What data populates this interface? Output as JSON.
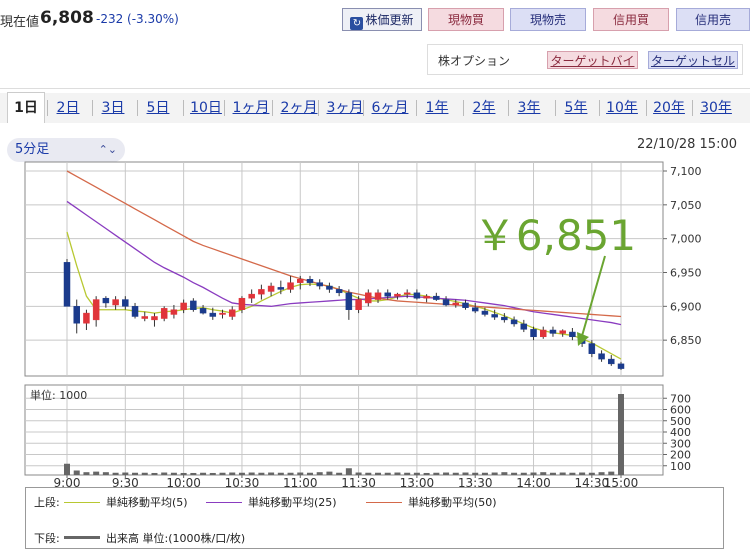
{
  "header": {
    "label": "現在値",
    "price": "6,808",
    "change": "-232 (-3.30%)",
    "update_button": "株価更新",
    "buttons": [
      "現物買",
      "現物売",
      "信用買",
      "信用売"
    ]
  },
  "options": {
    "label": "株オプション",
    "target_buy": "ターゲットバイ",
    "target_sell": "ターゲットセル"
  },
  "tabs": [
    "1日",
    "2日",
    "3日",
    "5日",
    "10日",
    "1ヶ月",
    "2ヶ月",
    "3ヶ月",
    "6ヶ月",
    "1年",
    "2年",
    "3年",
    "5年",
    "10年",
    "20年",
    "30年"
  ],
  "active_tab": "1日",
  "interval_select": "5分足",
  "datetime": "22/10/28 15:00",
  "annotation": {
    "text": "￥6,851",
    "color": "#6aa531"
  },
  "colors": {
    "up": "#e0343a",
    "down": "#1b3b8c",
    "ma5": "#b8c832",
    "ma25": "#8a3cc0",
    "ma50": "#d4694a",
    "volume": "#666666"
  },
  "chart_data": [
    {
      "type": "candlestick",
      "title": "",
      "x_ticks": [
        "9:00",
        "9:30",
        "10:00",
        "10:30",
        "11:00",
        "11:30",
        "13:00",
        "13:30",
        "14:00",
        "14:30",
        "15:00"
      ],
      "y_ticks": [
        "7,100",
        "7,050",
        "7,000",
        "6,950",
        "6,900",
        "6,850"
      ],
      "ylim": [
        6800,
        7100
      ],
      "grid": true,
      "candles": [
        {
          "o": 6965,
          "h": 6970,
          "l": 6900,
          "c": 6900
        },
        {
          "o": 6900,
          "h": 6910,
          "l": 6860,
          "c": 6875
        },
        {
          "o": 6875,
          "h": 6895,
          "l": 6865,
          "c": 6890
        },
        {
          "o": 6880,
          "h": 6915,
          "l": 6870,
          "c": 6910
        },
        {
          "o": 6912,
          "h": 6915,
          "l": 6898,
          "c": 6905
        },
        {
          "o": 6902,
          "h": 6915,
          "l": 6895,
          "c": 6910
        },
        {
          "o": 6910,
          "h": 6915,
          "l": 6895,
          "c": 6900
        },
        {
          "o": 6900,
          "h": 6905,
          "l": 6882,
          "c": 6885
        },
        {
          "o": 6882,
          "h": 6892,
          "l": 6878,
          "c": 6885
        },
        {
          "o": 6880,
          "h": 6890,
          "l": 6870,
          "c": 6885
        },
        {
          "o": 6882,
          "h": 6900,
          "l": 6878,
          "c": 6897
        },
        {
          "o": 6888,
          "h": 6902,
          "l": 6882,
          "c": 6895
        },
        {
          "o": 6895,
          "h": 6910,
          "l": 6890,
          "c": 6905
        },
        {
          "o": 6908,
          "h": 6912,
          "l": 6892,
          "c": 6895
        },
        {
          "o": 6897,
          "h": 6902,
          "l": 6888,
          "c": 6890
        },
        {
          "o": 6890,
          "h": 6898,
          "l": 6880,
          "c": 6885
        },
        {
          "o": 6888,
          "h": 6895,
          "l": 6882,
          "c": 6890
        },
        {
          "o": 6885,
          "h": 6900,
          "l": 6880,
          "c": 6895
        },
        {
          "o": 6895,
          "h": 6915,
          "l": 6890,
          "c": 6912
        },
        {
          "o": 6912,
          "h": 6925,
          "l": 6905,
          "c": 6918
        },
        {
          "o": 6918,
          "h": 6932,
          "l": 6910,
          "c": 6925
        },
        {
          "o": 6922,
          "h": 6935,
          "l": 6915,
          "c": 6930
        },
        {
          "o": 6928,
          "h": 6938,
          "l": 6918,
          "c": 6925
        },
        {
          "o": 6925,
          "h": 6945,
          "l": 6920,
          "c": 6935
        },
        {
          "o": 6935,
          "h": 6945,
          "l": 6925,
          "c": 6940
        },
        {
          "o": 6940,
          "h": 6945,
          "l": 6930,
          "c": 6935
        },
        {
          "o": 6935,
          "h": 6940,
          "l": 6925,
          "c": 6930
        },
        {
          "o": 6930,
          "h": 6935,
          "l": 6920,
          "c": 6925
        },
        {
          "o": 6925,
          "h": 6930,
          "l": 6915,
          "c": 6920
        },
        {
          "o": 6920,
          "h": 6925,
          "l": 6880,
          "c": 6895
        },
        {
          "o": 6895,
          "h": 6915,
          "l": 6890,
          "c": 6910
        },
        {
          "o": 6905,
          "h": 6925,
          "l": 6900,
          "c": 6920
        },
        {
          "o": 6910,
          "h": 6925,
          "l": 6905,
          "c": 6920
        },
        {
          "o": 6920,
          "h": 6925,
          "l": 6910,
          "c": 6915
        },
        {
          "o": 6915,
          "h": 6920,
          "l": 6910,
          "c": 6918
        },
        {
          "o": 6918,
          "h": 6925,
          "l": 6912,
          "c": 6920
        },
        {
          "o": 6920,
          "h": 6925,
          "l": 6910,
          "c": 6912
        },
        {
          "o": 6912,
          "h": 6918,
          "l": 6906,
          "c": 6915
        },
        {
          "o": 6915,
          "h": 6920,
          "l": 6908,
          "c": 6910
        },
        {
          "o": 6910,
          "h": 6915,
          "l": 6900,
          "c": 6902
        },
        {
          "o": 6902,
          "h": 6910,
          "l": 6898,
          "c": 6905
        },
        {
          "o": 6905,
          "h": 6910,
          "l": 6895,
          "c": 6898
        },
        {
          "o": 6898,
          "h": 6905,
          "l": 6890,
          "c": 6893
        },
        {
          "o": 6893,
          "h": 6898,
          "l": 6885,
          "c": 6888
        },
        {
          "o": 6888,
          "h": 6895,
          "l": 6880,
          "c": 6884
        },
        {
          "o": 6884,
          "h": 6890,
          "l": 6876,
          "c": 6880
        },
        {
          "o": 6880,
          "h": 6885,
          "l": 6870,
          "c": 6874
        },
        {
          "o": 6874,
          "h": 6880,
          "l": 6862,
          "c": 6866
        },
        {
          "o": 6866,
          "h": 6870,
          "l": 6850,
          "c": 6855
        },
        {
          "o": 6855,
          "h": 6870,
          "l": 6852,
          "c": 6865
        },
        {
          "o": 6865,
          "h": 6870,
          "l": 6855,
          "c": 6860
        },
        {
          "o": 6860,
          "h": 6866,
          "l": 6855,
          "c": 6864
        },
        {
          "o": 6862,
          "h": 6868,
          "l": 6850,
          "c": 6855
        },
        {
          "o": 6855,
          "h": 6860,
          "l": 6840,
          "c": 6845
        },
        {
          "o": 6845,
          "h": 6850,
          "l": 6825,
          "c": 6830
        },
        {
          "o": 6830,
          "h": 6835,
          "l": 6818,
          "c": 6822
        },
        {
          "o": 6822,
          "h": 6828,
          "l": 6812,
          "c": 6815
        },
        {
          "o": 6815,
          "h": 6818,
          "l": 6806,
          "c": 6808
        }
      ],
      "series": [
        {
          "name": "単純移動平均(5)",
          "key": "ma5",
          "values": [
            7010,
            6960,
            6915,
            6895,
            6895,
            6895,
            6895,
            6893,
            6892,
            6890,
            6892,
            6893,
            6895,
            6897,
            6898,
            6895,
            6893,
            6890,
            6895,
            6900,
            6908,
            6915,
            6922,
            6928,
            6932,
            6933,
            6932,
            6930,
            6925,
            6918,
            6912,
            6908,
            6908,
            6910,
            6914,
            6918,
            6917,
            6915,
            6912,
            6910,
            6907,
            6904,
            6900,
            6896,
            6891,
            6886,
            6880,
            6874,
            6868,
            6864,
            6861,
            6859,
            6857,
            6852,
            6846,
            6838,
            6830,
            6822
          ]
        },
        {
          "name": "単純移動平均(25)",
          "key": "ma25",
          "values": [
            7055,
            7045,
            7035,
            7025,
            7015,
            7005,
            6995,
            6985,
            6975,
            6965,
            6957,
            6950,
            6943,
            6935,
            6928,
            6920,
            6912,
            6905,
            6903,
            6902,
            6901,
            6900,
            6902,
            6904,
            6905,
            6906,
            6907,
            6908,
            6909,
            6910,
            6910,
            6911,
            6912,
            6913,
            6914,
            6915,
            6914,
            6913,
            6912,
            6911,
            6910,
            6909,
            6907,
            6905,
            6903,
            6901,
            6898,
            6895,
            6892,
            6890,
            6888,
            6886,
            6884,
            6882,
            6880,
            6878,
            6876,
            6873
          ]
        },
        {
          "name": "単純移動平均(50)",
          "key": "ma50",
          "values": [
            7100,
            7092,
            7084,
            7076,
            7068,
            7060,
            7052,
            7044,
            7036,
            7028,
            7020,
            7012,
            7004,
            6996,
            6990,
            6985,
            6980,
            6975,
            6970,
            6965,
            6960,
            6955,
            6950,
            6945,
            6941,
            6937,
            6933,
            6929,
            6925,
            6921,
            6918,
            6915,
            6912,
            6910,
            6908,
            6907,
            6906,
            6905,
            6904,
            6903,
            6902,
            6901,
            6900,
            6899,
            6898,
            6897,
            6896,
            6895,
            6894,
            6893,
            6892,
            6891,
            6890,
            6889,
            6888,
            6887,
            6886,
            6885
          ]
        }
      ]
    },
    {
      "type": "bar",
      "title": "",
      "unit_label": "単位: 1000",
      "y_ticks": [
        "700",
        "600",
        "500",
        "400",
        "300",
        "200",
        "100"
      ],
      "ylim": [
        0,
        720
      ],
      "values": [
        100,
        40,
        25,
        30,
        25,
        20,
        22,
        20,
        20,
        18,
        22,
        20,
        18,
        18,
        20,
        18,
        20,
        22,
        20,
        22,
        20,
        22,
        20,
        20,
        22,
        20,
        25,
        30,
        20,
        60,
        22,
        20,
        20,
        20,
        22,
        20,
        20,
        18,
        20,
        22,
        20,
        22,
        20,
        20,
        22,
        25,
        20,
        20,
        22,
        25,
        20,
        22,
        20,
        22,
        20,
        25,
        30,
        720
      ]
    }
  ],
  "legend": {
    "upper_label": "上段:",
    "lower_label": "下段:",
    "ma5": "単純移動平均(5)",
    "ma25": "単純移動平均(25)",
    "ma50": "単純移動平均(50)",
    "volume": "出来高 単位:(1000株/口/枚)"
  }
}
